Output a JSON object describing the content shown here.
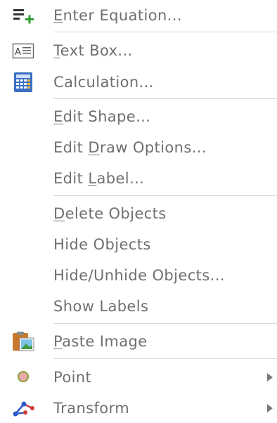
{
  "menu": {
    "items": [
      {
        "pre": "",
        "ul": "E",
        "post": "nter Equation...",
        "icon": "enter-equation-icon"
      },
      {
        "pre": "",
        "ul": "T",
        "post": "ext Box...",
        "icon": "text-box-icon"
      },
      {
        "pre": "Calculation...",
        "ul": "",
        "post": "",
        "icon": "calculator-icon"
      },
      {
        "pre": "",
        "ul": "E",
        "post": "dit Shape..."
      },
      {
        "pre": "Edit ",
        "ul": "D",
        "post": "raw Options..."
      },
      {
        "pre": "Edit ",
        "ul": "L",
        "post": "abel..."
      },
      {
        "pre": "",
        "ul": "D",
        "post": "elete Objects"
      },
      {
        "pre": "Hide Objects",
        "ul": "",
        "post": ""
      },
      {
        "pre": "Hide/Unhide Objects...",
        "ul": "",
        "post": ""
      },
      {
        "pre": "Show Labels",
        "ul": "",
        "post": ""
      },
      {
        "pre": "",
        "ul": "P",
        "post": "aste Image",
        "icon": "paste-image-icon"
      },
      {
        "pre": "Point",
        "ul": "",
        "post": "",
        "icon": "point-icon",
        "submenu": true
      },
      {
        "pre": "Transform",
        "ul": "",
        "post": "",
        "icon": "transform-icon",
        "submenu": true
      }
    ]
  },
  "colors": {
    "text": "#6f6f6f",
    "separator": "#d8d8d8",
    "accent_green": "#2e9e2e",
    "calculator_blue": "#3a6fc4",
    "point_fill": "#e8a9a9",
    "transform_blue": "#2f59c7",
    "transform_red": "#d23a3a"
  }
}
